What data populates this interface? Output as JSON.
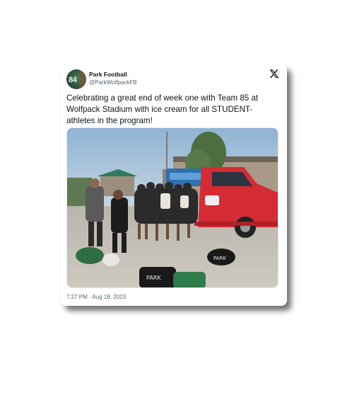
{
  "tweet": {
    "author_name": "Park Football",
    "author_handle": "@ParkWolfpackFB",
    "avatar_text": "84",
    "text": "Celebrating a great end of week one with Team 85 at Wolfpack Stadium with ice cream for all STUDENT-athletes in the program!",
    "timestamp": "7:27 PM · Aug 18, 2023",
    "bag_text": "PARK",
    "logo_icon": "x-logo-icon"
  },
  "colors": {
    "text_primary": "#0f1419",
    "text_secondary": "#536471",
    "truck_red": "#d42b35"
  }
}
